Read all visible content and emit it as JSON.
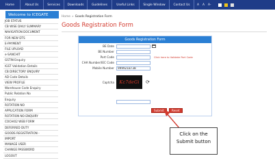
{
  "topnav": {
    "items": [
      "Home",
      "About Us",
      "Services",
      "Downloads",
      "Guidelines",
      "Useful Links",
      "Single Window",
      "Contact Us"
    ],
    "font_sizes": [
      "A",
      "A",
      "A-"
    ],
    "swatch_colors": [
      "#ffffff",
      "#f0c419",
      "#e3e3e3"
    ]
  },
  "sidebar": {
    "welcome": "Welcome to ICEGATE",
    "items": [
      "JOB STATUS",
      "CB WISE DAILY SUMMARY",
      "NAVIGATION DOCUMENT",
      "FOR NEW DTS",
      "E-PAYMENT",
      "FILE UPLOAD",
      "e-SANCHIT",
      "GSTIN Enquiry",
      "IGST Validation Details",
      "CB DIRECTORY ENQUIRY",
      "AD Code Details",
      "VIEW PROFILE",
      "Warehouse Code Enquiry",
      "Public Relation No",
      "Enquiry",
      "ROTATION NO",
      "APPLICATION FORM",
      "ROTATION NO ENQUIRY",
      "COCHI02 WEB FORM",
      "DEFERRED DUTY",
      "GOODS REGISTRATION -",
      "IMPORT",
      "MANAGE USER",
      "CHANGE PASSWORD",
      "LOGOUT"
    ]
  },
  "breadcrumb": {
    "home": "Home",
    "sep": "»",
    "current": "Goods Registration Form"
  },
  "page_title": "Goods Registration Form",
  "form": {
    "header": "Goods Registration Form",
    "fields": {
      "be_date": {
        "label": "BE Date",
        "value": ""
      },
      "be_number": {
        "label": "BE Number",
        "value": ""
      },
      "port_code": {
        "label": "Port Code",
        "value": "",
        "hint": "Click here to Validate Port Code"
      },
      "cha_number": {
        "label": "CHA Number/IEC Code",
        "value": ""
      },
      "mobile": {
        "label": "Mobile Number",
        "value": "9999218738"
      },
      "captcha": {
        "label": "Captcha",
        "text": "Kc7deGi",
        "value": ""
      }
    },
    "submit_label": "Submit",
    "reset_label": "Reset"
  },
  "annotation": {
    "line1": "Click on the",
    "line2": "Submit button",
    "color": "#d23a2e"
  }
}
